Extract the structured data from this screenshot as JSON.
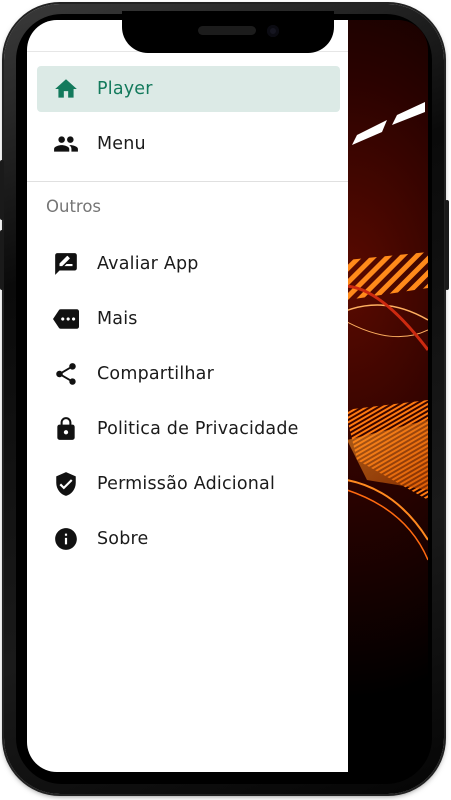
{
  "drawer": {
    "main_items": [
      {
        "label": "Player",
        "icon": "home-icon",
        "active": true
      },
      {
        "label": "Menu",
        "icon": "people-icon",
        "active": false
      }
    ],
    "section_title": "Outros",
    "other_items": [
      {
        "label": "Avaliar App",
        "icon": "rate-review-icon"
      },
      {
        "label": "Mais",
        "icon": "more-tag-icon"
      },
      {
        "label": "Compartilhar",
        "icon": "share-icon"
      },
      {
        "label": "Politica de Privacidade",
        "icon": "lock-icon"
      },
      {
        "label": "Permissão Adicional",
        "icon": "verified-shield-icon"
      },
      {
        "label": "Sobre",
        "icon": "info-icon"
      }
    ]
  },
  "colors": {
    "accent": "#137a5c",
    "active_background": "#dceae6",
    "text": "#1b1b1b",
    "section_text": "#757575"
  }
}
